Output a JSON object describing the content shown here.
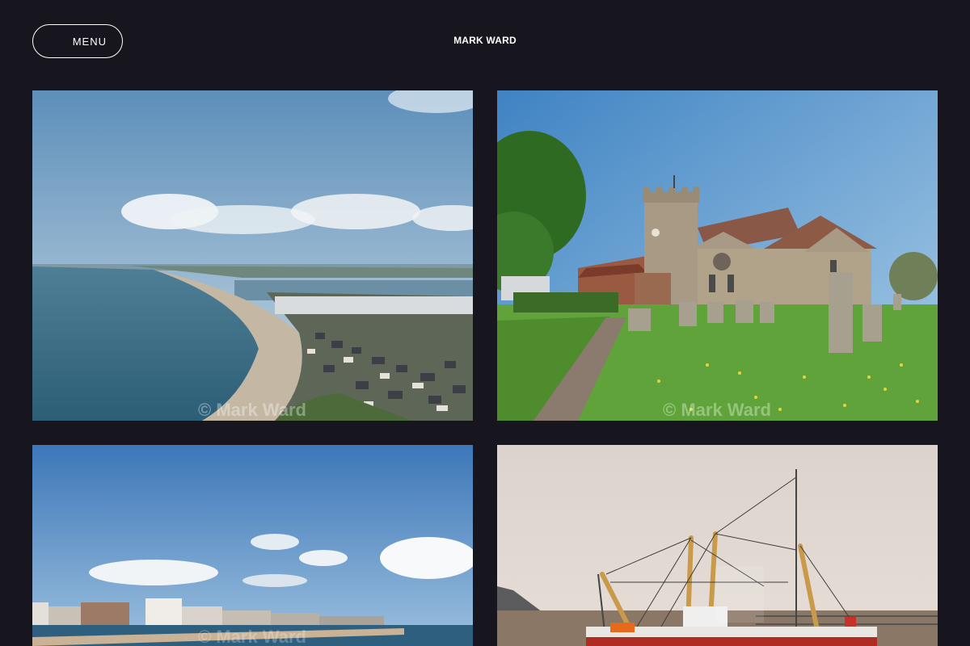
{
  "header": {
    "menu_label": "MENU",
    "site_title": "MARK WARD"
  },
  "gallery": {
    "watermark_text": "© Mark Ward",
    "photos": [
      {
        "subject": "coastline-aerial"
      },
      {
        "subject": "stone-church"
      },
      {
        "subject": "seafront-town"
      },
      {
        "subject": "fishing-boat"
      }
    ]
  }
}
